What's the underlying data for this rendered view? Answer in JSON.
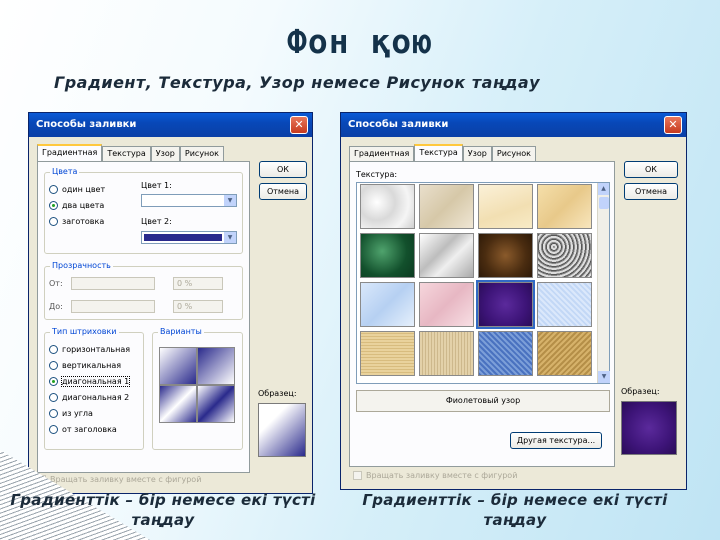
{
  "slide": {
    "title": "Фон қою",
    "subtitle": "Градиент, Текстура, Узор немесе Рисунок таңдау",
    "caption_left": "Градиенттік – бір немесе екі түсті таңдау",
    "caption_right": "Градиенттік – бір немесе екі түсті таңдау"
  },
  "dialog1": {
    "title": "Способы заливки",
    "close": "✕",
    "tabs": [
      "Градиентная",
      "Текстура",
      "Узор",
      "Рисунок"
    ],
    "ok": "ОК",
    "cancel": "Отмена",
    "colors_group": "Цвета",
    "radio_one": "один цвет",
    "radio_two": "два цвета",
    "radio_preset": "заготовка",
    "color1_label": "Цвет 1:",
    "color2_label": "Цвет 2:",
    "color2_value": "#2a2a8c",
    "transparency_group": "Прозрачность",
    "from_label": "От:",
    "to_label": "До:",
    "from_value": "0 %",
    "to_value": "0 %",
    "shading_group": "Тип штриховки",
    "shading": [
      "горизонтальная",
      "вертикальная",
      "диагональная 1",
      "диагональная 2",
      "из угла",
      "от заголовка"
    ],
    "variants_group": "Варианты",
    "sample_label": "Образец:",
    "rotate_check": "Вращать заливку вместе с фигурой"
  },
  "dialog2": {
    "title": "Способы заливки",
    "close": "✕",
    "tabs": [
      "Градиентная",
      "Текстура",
      "Узор",
      "Рисунок"
    ],
    "ok": "ОК",
    "cancel": "Отмена",
    "texture_label": "Текстура:",
    "texture_name": "Фиолетовый узор",
    "other_texture": "Другая текстура...",
    "sample_label": "Образец:",
    "rotate_check": "Вращать заливку вместе с фигурой",
    "textures": [
      "white-marble",
      "beige-paper",
      "light-parchment",
      "sand",
      "green-marble",
      "gray-marble",
      "brown-marble",
      "granite",
      "blue-tissue",
      "pink-tissue",
      "purple-mesh",
      "blue-fleck",
      "canvas",
      "burlap",
      "denim",
      "woven"
    ],
    "selected_texture_color": "#3d1478"
  }
}
